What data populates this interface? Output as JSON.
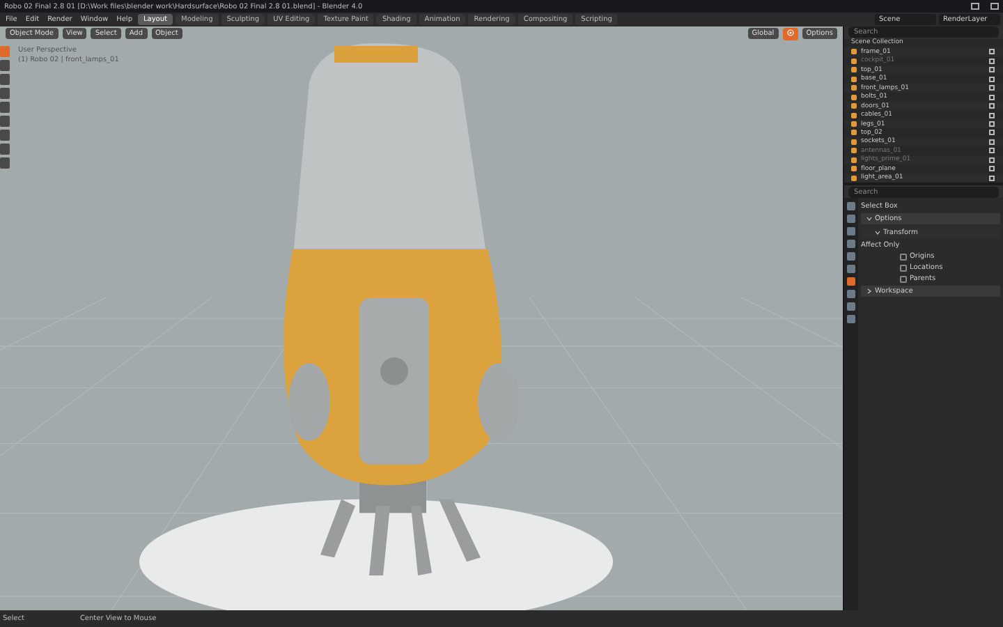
{
  "window": {
    "title": "Robo 02 Final 2.8 01 [D:\\Work files\\blender work\\Hardsurface\\Robo 02 Final 2.8 01.blend] - Blender 4.0"
  },
  "menu": [
    "File",
    "Edit",
    "Render",
    "Window",
    "Help"
  ],
  "workspace_tabs": [
    {
      "label": "Layout",
      "selected": true
    },
    {
      "label": "Modeling",
      "selected": false
    },
    {
      "label": "Sculpting",
      "selected": false
    },
    {
      "label": "UV Editing",
      "selected": false
    },
    {
      "label": "Texture Paint",
      "selected": false
    },
    {
      "label": "Shading",
      "selected": false
    },
    {
      "label": "Animation",
      "selected": false
    },
    {
      "label": "Rendering",
      "selected": false
    },
    {
      "label": "Compositing",
      "selected": false
    },
    {
      "label": "Scripting",
      "selected": false
    }
  ],
  "scene": {
    "name": "Scene",
    "view_layer": "RenderLayer"
  },
  "viewport": {
    "mode": "Object Mode",
    "menus": [
      "View",
      "Select",
      "Add",
      "Object"
    ],
    "orientation": "Global",
    "options": "Options",
    "overlay_title": "User Perspective",
    "overlay_info": "(1) Robo 02 | front_lamps_01"
  },
  "outliner": {
    "search": {
      "placeholder": "Search"
    },
    "root": "Scene Collection",
    "items": [
      {
        "name": "frame_01",
        "dimmed": false
      },
      {
        "name": "cockpit_01",
        "dimmed": true
      },
      {
        "name": "top_01",
        "dimmed": false
      },
      {
        "name": "base_01",
        "dimmed": false
      },
      {
        "name": "front_lamps_01",
        "dimmed": false
      },
      {
        "name": "bolts_01",
        "dimmed": false
      },
      {
        "name": "doors_01",
        "dimmed": false
      },
      {
        "name": "cables_01",
        "dimmed": false
      },
      {
        "name": "legs_01",
        "dimmed": false
      },
      {
        "name": "top_02",
        "dimmed": false
      },
      {
        "name": "sockets_01",
        "dimmed": false
      },
      {
        "name": "antennas_01",
        "dimmed": true
      },
      {
        "name": "lights_prime_01",
        "dimmed": true
      },
      {
        "name": "floor_plane",
        "dimmed": false
      },
      {
        "name": "light_area_01",
        "dimmed": false
      }
    ]
  },
  "properties": {
    "search": {
      "placeholder": "Search"
    },
    "tool": "Select Box",
    "sections": [
      {
        "label": "Options",
        "expanded": true
      },
      {
        "label": "Transform",
        "expanded": true
      }
    ],
    "affect_label": "Affect Only",
    "checks": [
      {
        "label": "Origins",
        "checked": false
      },
      {
        "label": "Locations",
        "checked": false
      },
      {
        "label": "Parents",
        "checked": false
      }
    ],
    "workspace": {
      "label": "Workspace",
      "expanded": false
    }
  },
  "status_bar": {
    "left": "Select",
    "middle": "Center View to Mouse"
  }
}
